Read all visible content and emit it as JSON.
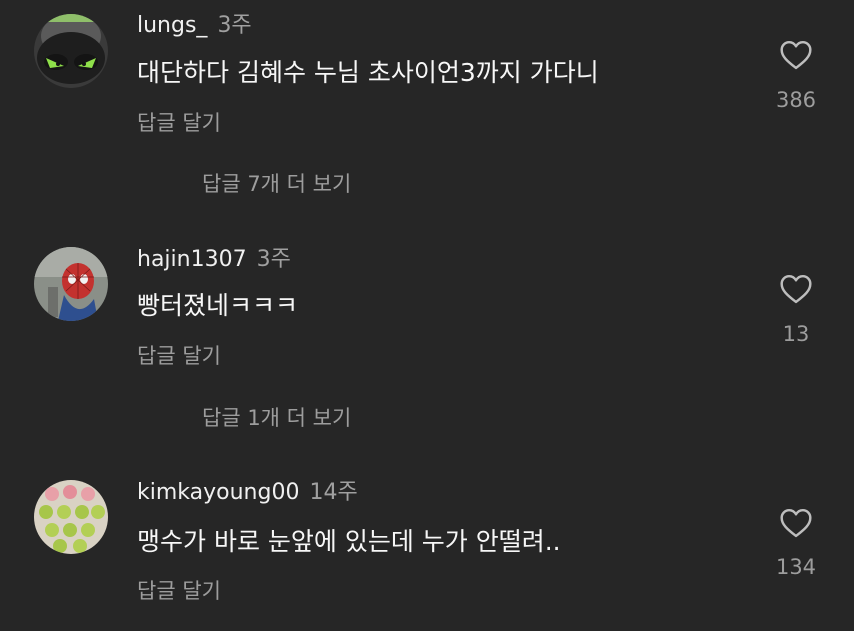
{
  "comments": [
    {
      "username": "lungs_",
      "time": "3주",
      "text": "대단하다 김혜수 누님 초사이언3까지 가다니",
      "reply_label": "답글 달기",
      "more_replies": "답글 7개 더 보기",
      "likes": "386",
      "avatar_icon": "green-eyed-monster-avatar"
    },
    {
      "username": "hajin1307",
      "time": "3주",
      "text": "빵터졌네ㅋㅋㅋ",
      "reply_label": "답글 달기",
      "more_replies": "답글 1개 더 보기",
      "likes": "13",
      "avatar_icon": "spiderman-avatar"
    },
    {
      "username": "kimkayoung00",
      "time": "14주",
      "text": "맹수가 바로 눈앞에 있는데 누가 안떨려..",
      "reply_label": "답글 달기",
      "likes": "134",
      "avatar_icon": "macarons-avatar"
    }
  ],
  "icons": {
    "like": "heart-outline-icon"
  },
  "colors": {
    "background": "#262626",
    "text": "#f2f2f2",
    "secondary": "#9d9d9d"
  }
}
